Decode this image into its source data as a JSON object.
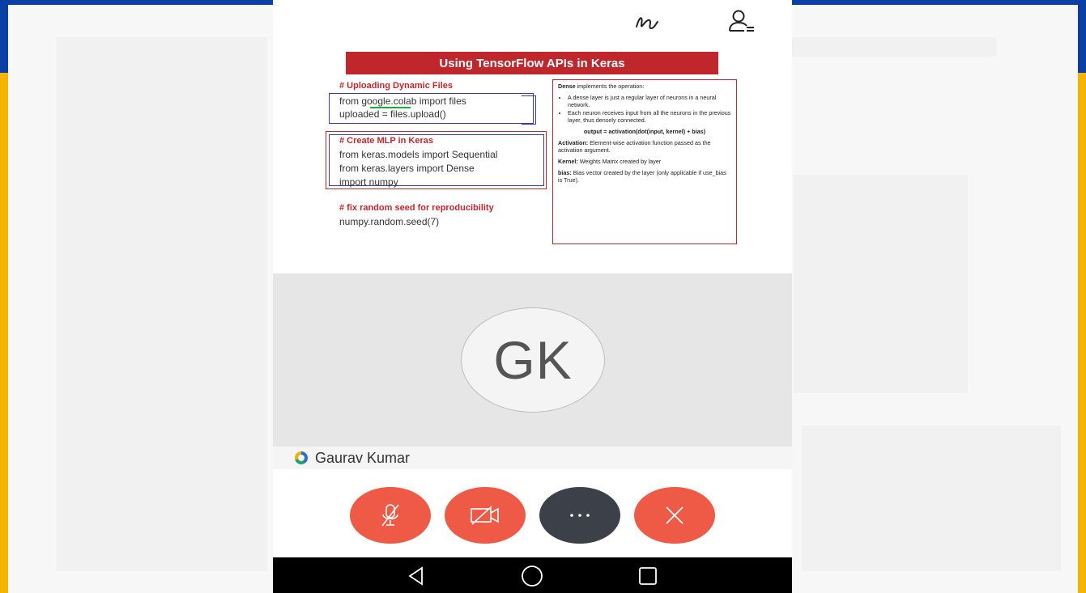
{
  "slide": {
    "title": "Using TensorFlow APIs in Keras",
    "code": {
      "upload_heading": "# Uploading Dynamic Files",
      "upload_line1": "from google.colab import files",
      "upload_line2": "uploaded = files.upload()",
      "mlp_heading": "# Create MLP in Keras",
      "mlp_line1": "from keras.models import Sequential",
      "mlp_line2": "from keras.layers import Dense",
      "mlp_line3": "import numpy",
      "seed_heading": "# fix random seed for reproducibility",
      "seed_line1": "numpy.random.seed(7)"
    },
    "dense_box": {
      "intro_bold": "Dense",
      "intro_rest": " implements the operation:",
      "bullet1": "A dense layer is just a regular layer of neurons in a neural network.",
      "bullet2": "Each neuron receives input from all the neurons in the previous layer, thus densely connected.",
      "formula": "output = activation(dot(input, kernel) + bias)",
      "activation_label": "Activation:",
      "activation_text": " Element-wise activation function passed as the activation argument.",
      "kernel_label": "Kernel:",
      "kernel_text": " Weights Matrix created by layer",
      "bias_label": "bias:",
      "bias_text": " Bias vector created by the layer (only applicable if use_bias is True)."
    }
  },
  "participant": {
    "initials": "GK",
    "name": "Gaurav Kumar"
  },
  "icons": {
    "draw": "scribble-icon",
    "participants": "participants-icon",
    "mute": "mic-off-icon",
    "video": "video-off-icon",
    "more": "more-icon",
    "end": "close-icon",
    "back": "nav-back-icon",
    "home": "nav-home-icon",
    "recents": "nav-recents-icon"
  },
  "colors": {
    "accent_red": "#ee5a45",
    "dark_button": "#3c4048",
    "slide_title_bg": "#c0272d",
    "frame_blue": "#0b3fa6",
    "frame_yellow": "#f5b400"
  }
}
